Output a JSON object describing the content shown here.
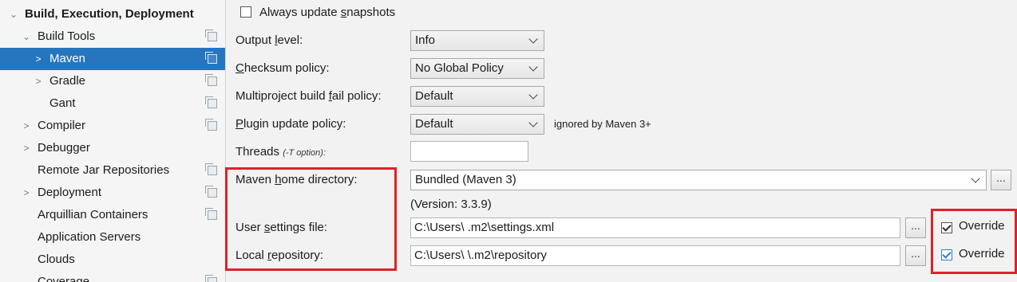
{
  "sidebar": {
    "section_title": "Build, Execution, Deployment",
    "items": [
      {
        "label": "Build Tools"
      },
      {
        "label": "Maven"
      },
      {
        "label": "Gradle"
      },
      {
        "label": "Gant"
      },
      {
        "label": "Compiler"
      },
      {
        "label": "Debugger"
      },
      {
        "label": "Remote Jar Repositories"
      },
      {
        "label": "Deployment"
      },
      {
        "label": "Arquillian Containers"
      },
      {
        "label": "Application Servers"
      },
      {
        "label": "Clouds"
      },
      {
        "label": "Coverage"
      }
    ]
  },
  "form": {
    "always_update_snapshots": {
      "pre": "Always update ",
      "u": "s",
      "post": "napshots",
      "checked": false
    },
    "output_level": {
      "pre": "Output ",
      "u": "l",
      "post": "evel:",
      "value": "Info"
    },
    "checksum_policy": {
      "pre": "",
      "u": "C",
      "post": "hecksum policy:",
      "value": "No Global Policy"
    },
    "multiproject_fail_policy": {
      "pre": "Multiproject build ",
      "u": "f",
      "post": "ail policy:",
      "value": "Default"
    },
    "plugin_update_policy": {
      "pre": "",
      "u": "P",
      "post": "lugin update policy:",
      "value": "Default",
      "note": "ignored by Maven 3+"
    },
    "threads": {
      "label": "Threads",
      "hint": "(-T option):",
      "value": ""
    },
    "maven_home": {
      "pre": "Maven ",
      "u": "h",
      "post": "ome directory:",
      "value": "Bundled (Maven 3)",
      "version": "(Version: 3.3.9)"
    },
    "user_settings": {
      "pre": "User ",
      "u": "s",
      "post": "ettings file:",
      "value": "C:\\Users\\        .m2\\settings.xml",
      "override_label": "Override",
      "override_checked": true
    },
    "local_repository": {
      "pre": "Local ",
      "u": "r",
      "post": "epository:",
      "value": "C:\\Users\\       \\.m2\\repository",
      "override_label": "Override",
      "override_checked": true
    },
    "browse_label": "...",
    "colors": {
      "selection": "#2675bf",
      "highlight_box": "#e0202a"
    }
  }
}
